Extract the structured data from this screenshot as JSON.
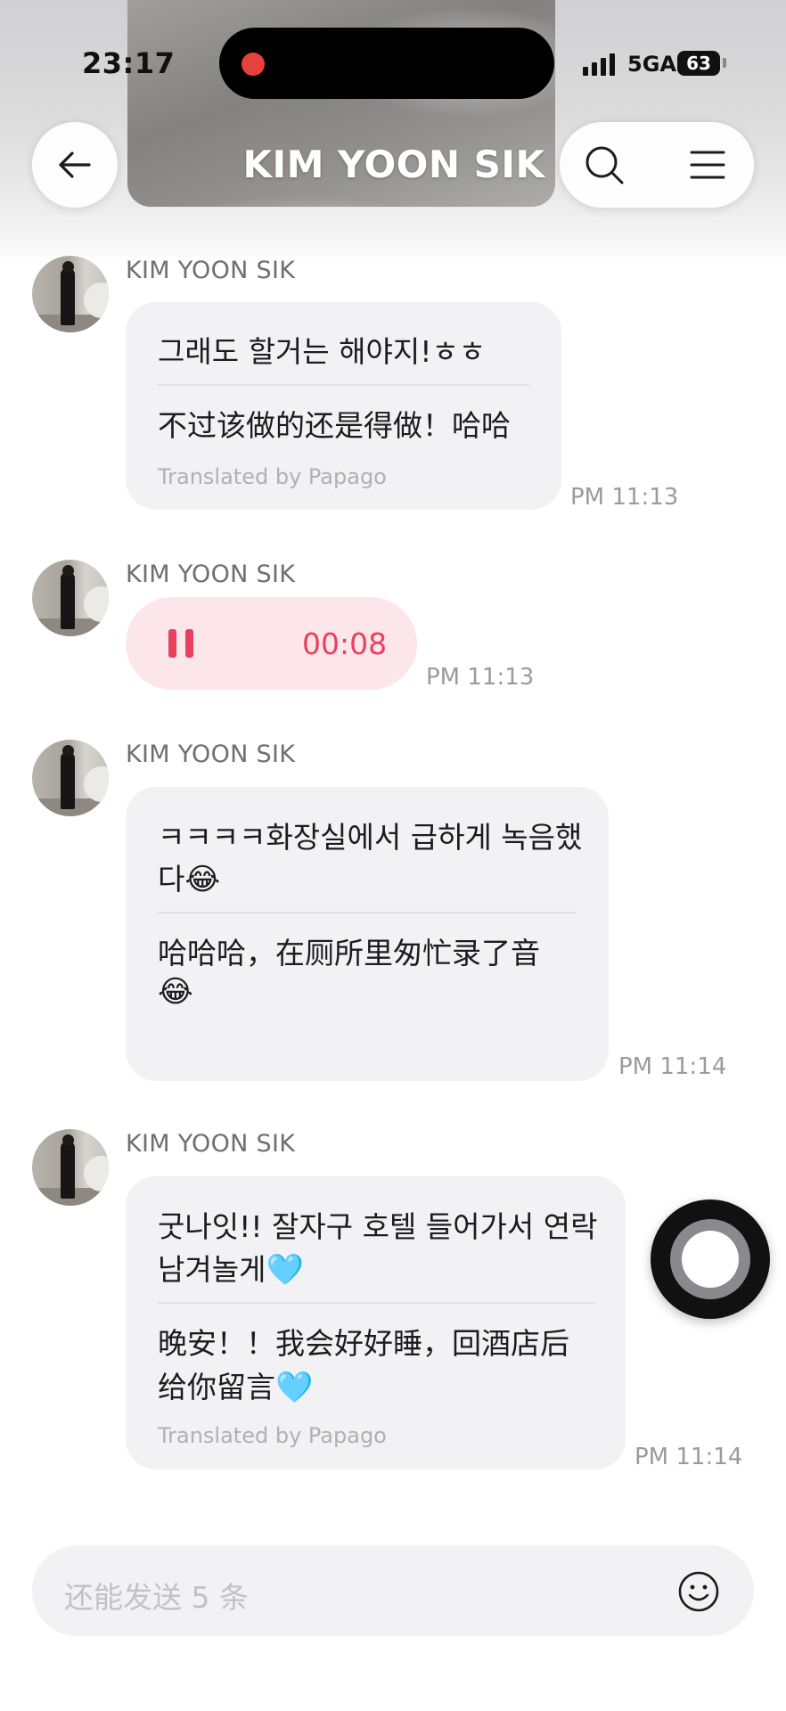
{
  "status_bar": {
    "time": "23:17",
    "network": "5GA",
    "battery": "63"
  },
  "header": {
    "title": "KIM YOON SIK"
  },
  "messages": [
    {
      "sender": "KIM YOON SIK",
      "original": [
        "그래도 할거는 해야지!ㅎㅎ"
      ],
      "translation": [
        "不过该做的还是得做！哈哈"
      ],
      "credit": "Translated by Papago",
      "time": "PM 11:13"
    },
    {
      "sender": "KIM YOON SIK",
      "voice_duration": "00:08",
      "time": "PM 11:13"
    },
    {
      "sender": "KIM YOON SIK",
      "original": [
        "ㅋㅋㅋㅋ화장실에서 급하게 녹음했",
        "다"
      ],
      "translation": [
        "哈哈哈，在厕所里匆忙录了音",
        ""
      ],
      "time": "PM 11:14"
    },
    {
      "sender": "KIM YOON SIK",
      "original": [
        "굿나잇!! 잘자구 호텔 들어가서 연락",
        "남겨놀게"
      ],
      "translation": [
        "晚安！！我会好好睡，回酒店后",
        "给你留言"
      ],
      "credit": "Translated by Papago",
      "time": "PM 11:14"
    }
  ],
  "emoji": {
    "laugh": "😂",
    "heart": "🩵"
  },
  "input": {
    "placeholder": "还能发送 5 条"
  },
  "icons": {
    "back": "back-arrow-icon",
    "search": "search-icon",
    "menu": "menu-icon",
    "emoji": "smiley-icon",
    "record": "record-dot-icon",
    "pause": "pause-icon"
  },
  "colors": {
    "accent": "#e8405e",
    "bubble": "#f2f2f4",
    "voice_bubble": "#fde6ea"
  }
}
